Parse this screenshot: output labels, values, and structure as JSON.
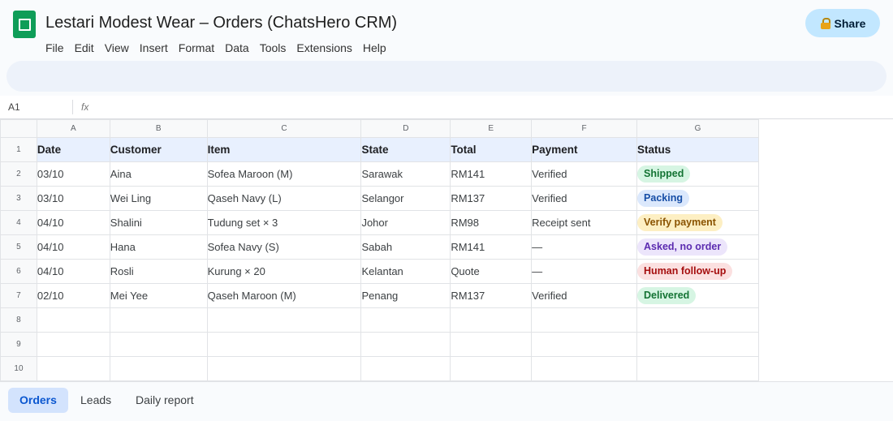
{
  "window": {
    "title": "Lestari Modest Wear – Orders (ChatsHero CRM)",
    "share_label": "Share"
  },
  "menu": [
    "File",
    "Edit",
    "View",
    "Insert",
    "Format",
    "Data",
    "Tools",
    "Extensions",
    "Help"
  ],
  "formula_bar": {
    "cell_ref": "A1",
    "fx": "fx"
  },
  "columns": [
    "A",
    "B",
    "C",
    "D",
    "E",
    "F",
    "G"
  ],
  "row_numbers": [
    "1",
    "2",
    "3",
    "4",
    "5",
    "6",
    "7",
    "8",
    "9",
    "10"
  ],
  "table": {
    "headers": [
      "Date",
      "Customer",
      "Item",
      "State",
      "Total",
      "Payment",
      "Status"
    ],
    "rows": [
      {
        "cells": [
          "03/10",
          "Aina",
          "Sofea Maroon (M)",
          "Sarawak",
          "RM141",
          "Verified"
        ],
        "status": "Shipped",
        "status_bg": "#d6f5e3",
        "status_fg": "#137333"
      },
      {
        "cells": [
          "03/10",
          "Wei Ling",
          "Qaseh Navy (L)",
          "Selangor",
          "RM137",
          "Verified"
        ],
        "status": "Packing",
        "status_bg": "#dbe8fc",
        "status_fg": "#174ea6"
      },
      {
        "cells": [
          "04/10",
          "Shalini",
          "Tudung set × 3",
          "Johor",
          "RM98",
          "Receipt sent"
        ],
        "status": "Verify payment",
        "status_bg": "#fdefc3",
        "status_fg": "#8a5300"
      },
      {
        "cells": [
          "04/10",
          "Hana",
          "Sofea Navy (S)",
          "Sabah",
          "RM141",
          "—"
        ],
        "status": "Asked, no order",
        "status_bg": "#ece5fb",
        "status_fg": "#5b2bb0"
      },
      {
        "cells": [
          "04/10",
          "Rosli",
          "Kurung × 20",
          "Kelantan",
          "Quote",
          "—"
        ],
        "status": "Human follow-up",
        "status_bg": "#fbe0e0",
        "status_fg": "#a50e0e"
      },
      {
        "cells": [
          "02/10",
          "Mei Yee",
          "Qaseh Maroon (M)",
          "Penang",
          "RM137",
          "Verified"
        ],
        "status": "Delivered",
        "status_bg": "#d6f5e3",
        "status_fg": "#137333"
      }
    ]
  },
  "sheet_tabs": [
    "Orders",
    "Leads",
    "Daily report"
  ],
  "active_tab": "Orders",
  "colors": {
    "accent": "#0b57d0",
    "share_bg": "#c2e7ff",
    "header_row_bg": "#e8f0fe",
    "logo": "#0f9d58"
  }
}
